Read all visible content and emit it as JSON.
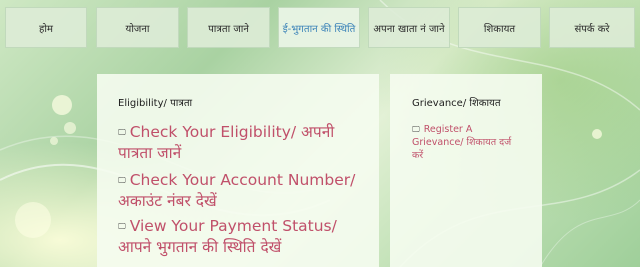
{
  "nav": {
    "items": [
      {
        "label": "होम"
      },
      {
        "label": "योजना"
      },
      {
        "label": "पात्रता जाने"
      },
      {
        "label": "ई-भुगतान की स्थिति"
      },
      {
        "label": "अपना खाता नं जाने"
      },
      {
        "label": "शिकायत"
      },
      {
        "label": "संपर्क करे"
      }
    ]
  },
  "eligibility_panel": {
    "title": "Eligibility/ पात्रता",
    "links": [
      {
        "line1": "Check Your Eligibility/ अपनी",
        "line2": "पात्रता जानें"
      },
      {
        "line1": "Check Your Account Number/",
        "line2": "अकाउंट नंबर देखें"
      },
      {
        "line1": "View Your Payment Status/",
        "line2": "आपने भुगतान की स्थिति देखें"
      }
    ]
  },
  "grievance_panel": {
    "title": "Grievance/ शिकायत",
    "link": {
      "line1": "Register A",
      "line2": "Grievance/ शिकायत दर्ज",
      "line3": "करें"
    }
  },
  "colors": {
    "link": "#c0506a",
    "active_nav": "#3a82b8",
    "icon": "monitor-icon"
  }
}
